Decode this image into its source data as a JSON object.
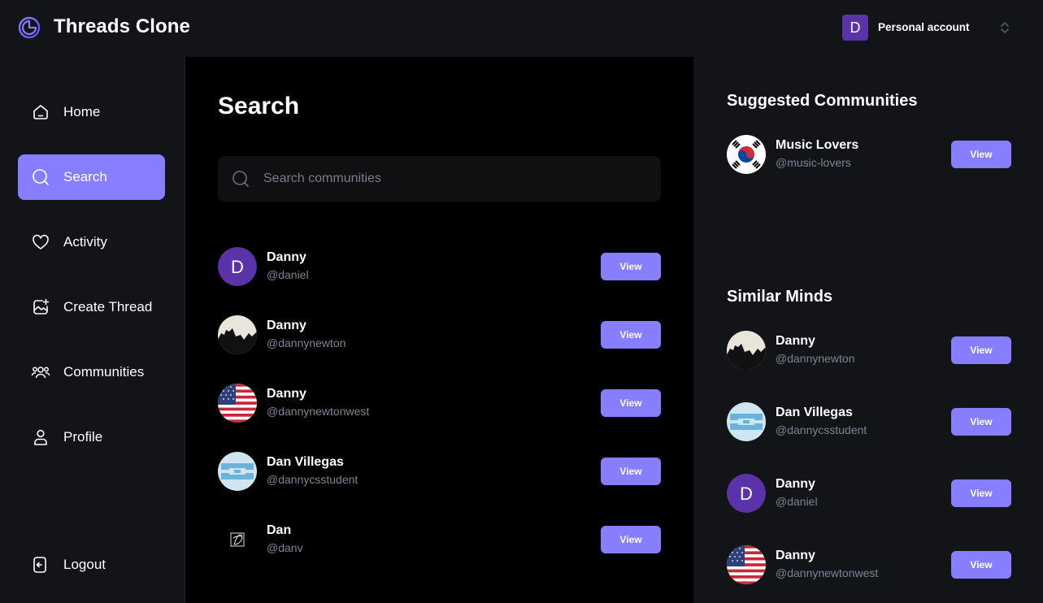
{
  "topbar": {
    "brand": "Threads Clone",
    "account_initial": "D",
    "account_label": "Personal account"
  },
  "sidebar": {
    "items": [
      {
        "label": "Home",
        "icon": "home-icon"
      },
      {
        "label": "Search",
        "icon": "search-icon",
        "active": true
      },
      {
        "label": "Activity",
        "icon": "heart-icon"
      },
      {
        "label": "Create Thread",
        "icon": "image-plus-icon"
      },
      {
        "label": "Communities",
        "icon": "users-icon"
      },
      {
        "label": "Profile",
        "icon": "user-icon"
      }
    ],
    "logout": {
      "label": "Logout",
      "icon": "logout-icon"
    }
  },
  "main": {
    "title": "Search",
    "search": {
      "placeholder": "Search communities",
      "value": ""
    },
    "results": [
      {
        "name": "Danny",
        "handle": "@daniel",
        "avatar": "letter-d",
        "button": "View"
      },
      {
        "name": "Danny",
        "handle": "@dannynewton",
        "avatar": "skyline",
        "button": "View"
      },
      {
        "name": "Danny",
        "handle": "@dannynewtonwest",
        "avatar": "us-flag",
        "button": "View"
      },
      {
        "name": "Dan Villegas",
        "handle": "@dannycsstudent",
        "avatar": "blue-logo",
        "button": "View"
      },
      {
        "name": "Dan",
        "handle": "@danv",
        "avatar": "signature-d",
        "button": "View"
      }
    ]
  },
  "right": {
    "suggested_title": "Suggested Communities",
    "communities": [
      {
        "name": "Music Lovers",
        "handle": "@music-lovers",
        "avatar": "korea-flag",
        "button": "View"
      }
    ],
    "similar_title": "Similar Minds",
    "similar": [
      {
        "name": "Danny",
        "handle": "@dannynewton",
        "avatar": "skyline",
        "button": "View"
      },
      {
        "name": "Dan Villegas",
        "handle": "@dannycsstudent",
        "avatar": "blue-logo",
        "button": "View"
      },
      {
        "name": "Danny",
        "handle": "@daniel",
        "avatar": "letter-d",
        "button": "View"
      },
      {
        "name": "Danny",
        "handle": "@dannynewtonwest",
        "avatar": "us-flag",
        "button": "View"
      }
    ]
  },
  "colors": {
    "accent": "#877eff",
    "background": "#121417",
    "main_background": "#000000",
    "muted_text": "#7d8494"
  }
}
